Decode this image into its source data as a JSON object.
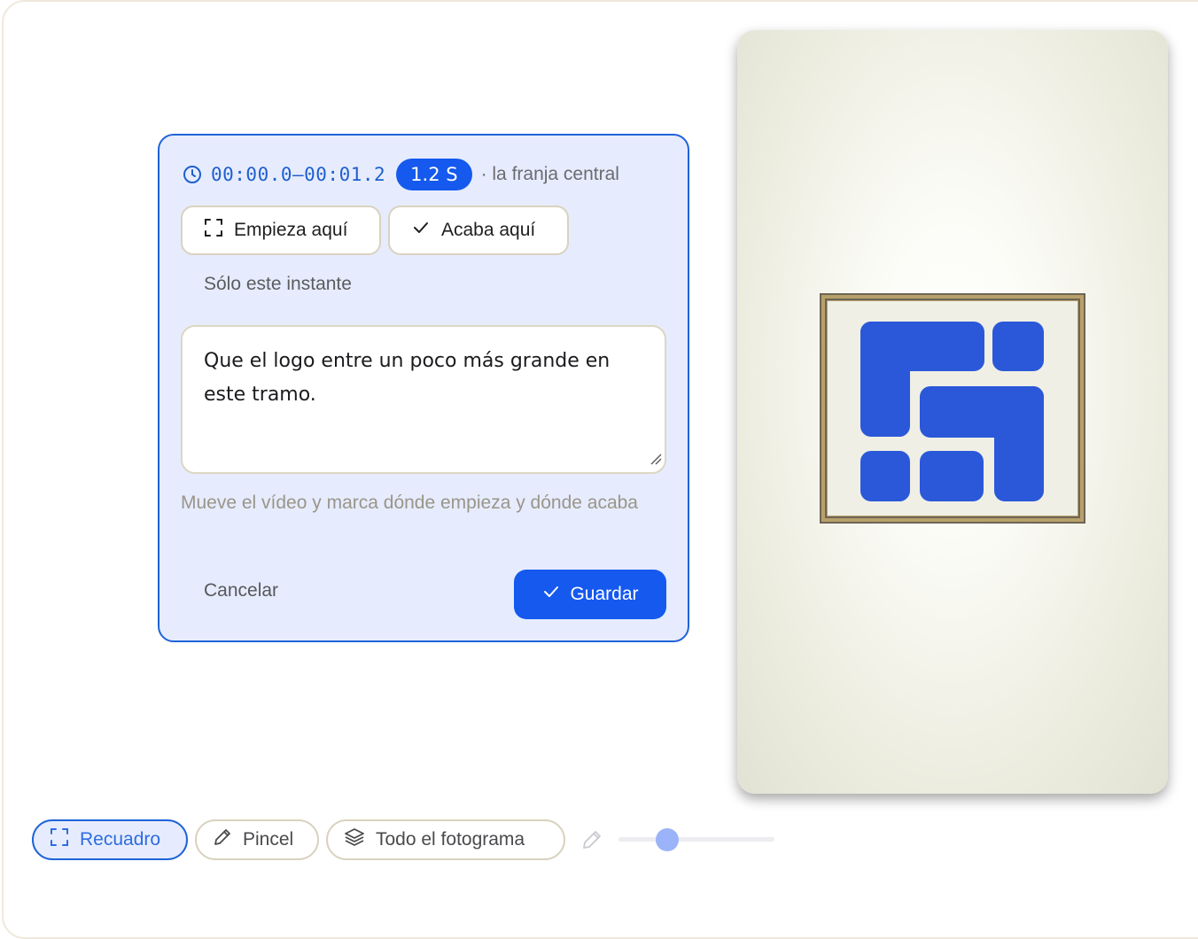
{
  "segment": {
    "time_range": "00:00.0–00:01.2",
    "duration_label": "1.2 S",
    "region_label": "· la franja central"
  },
  "actions": {
    "start_label": "Empieza aquí",
    "end_label": "Acaba aquí",
    "instant_label": "Sólo este instante"
  },
  "note": {
    "value": "Que el logo entre un poco más grande en este tramo."
  },
  "hint": "Mueve el vídeo y marca dónde empieza y dónde acaba",
  "footer": {
    "cancel_label": "Cancelar",
    "save_label": "Guardar"
  },
  "toolbar": {
    "tools": [
      "Recuadro",
      "Pincel",
      "Todo el fotograma"
    ],
    "active_tool": "Recuadro",
    "brush_size_fraction": 0.31
  },
  "colors": {
    "accent": "#1559ee",
    "popover_bg": "#e6ecfd",
    "logo_blue": "#2a58d8",
    "logo_frame": "#b8a06a"
  }
}
